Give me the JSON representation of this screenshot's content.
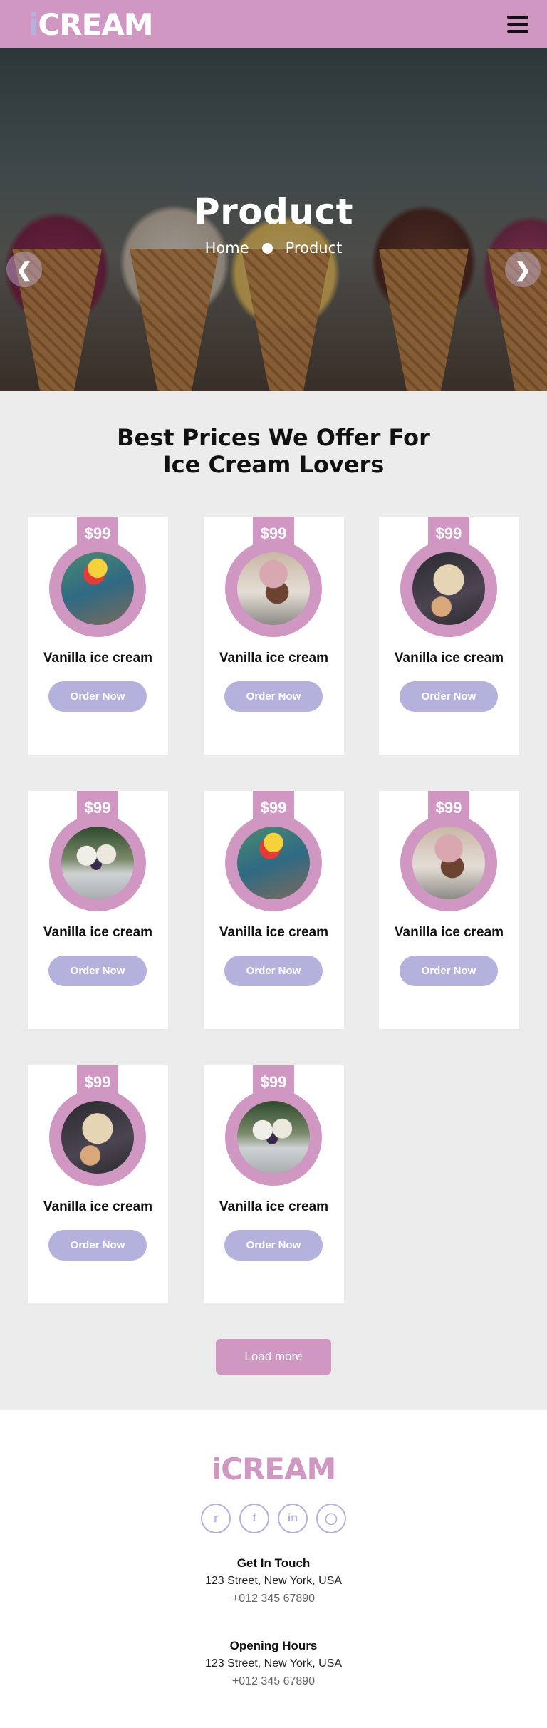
{
  "navbar": {
    "brand_i": "i",
    "brand_rest": "CREAM"
  },
  "hero": {
    "title": "Product",
    "breadcrumb": [
      "Home",
      "Product"
    ],
    "prev_icon": "chevron-left-icon",
    "next_icon": "chevron-right-icon"
  },
  "products": {
    "title_line1": "Best Prices We Offer For",
    "title_line2": "Ice Cream Lovers",
    "items": [
      {
        "price": "$99",
        "name": "Vanilla ice cream",
        "button": "Order Now",
        "image": "cone"
      },
      {
        "price": "$99",
        "name": "Vanilla ice cream",
        "button": "Order Now",
        "image": "sundae"
      },
      {
        "price": "$99",
        "name": "Vanilla ice cream",
        "button": "Order Now",
        "image": "rose"
      },
      {
        "price": "$99",
        "name": "Vanilla ice cream",
        "button": "Order Now",
        "image": "bowl"
      },
      {
        "price": "$99",
        "name": "Vanilla ice cream",
        "button": "Order Now",
        "image": "cone"
      },
      {
        "price": "$99",
        "name": "Vanilla ice cream",
        "button": "Order Now",
        "image": "sundae"
      },
      {
        "price": "$99",
        "name": "Vanilla ice cream",
        "button": "Order Now",
        "image": "rose"
      },
      {
        "price": "$99",
        "name": "Vanilla ice cream",
        "button": "Order Now",
        "image": "bowl"
      }
    ],
    "load_more": "Load more"
  },
  "footer": {
    "brand_i": "i",
    "brand_rest": "CREAM",
    "socials": [
      "twitter-icon",
      "facebook-icon",
      "linkedin-icon",
      "instagram-icon"
    ],
    "get_in_touch": {
      "heading": "Get In Touch",
      "address": "123 Street, New York, USA",
      "phone": "+012 345 67890"
    },
    "opening_hours": {
      "heading": "Opening Hours",
      "address": "123 Street, New York, USA",
      "phone": "+012 345 67890"
    }
  },
  "colors": {
    "brand_pink": "#cf97c1",
    "accent_lavender": "#b4b1dc",
    "section_bg": "#ececec"
  }
}
